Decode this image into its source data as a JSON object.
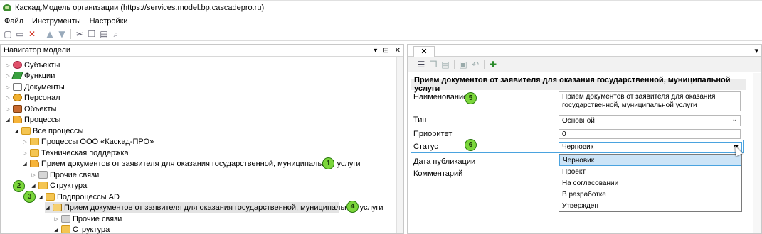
{
  "window": {
    "title": "Каскад.Модель организации (https://services.model.bp.cascadepro.ru)"
  },
  "menu": [
    "Файл",
    "Инструменты",
    "Настройки"
  ],
  "toolbar": {
    "icons": [
      "new-doc-icon",
      "open-icon",
      "delete-icon",
      "up-icon",
      "down-icon",
      "cut-icon",
      "copy-icon",
      "paste-icon",
      "preview-icon"
    ]
  },
  "navigator": {
    "title": "Навигатор модели",
    "header_buttons": [
      "▾",
      "⊞",
      "✕"
    ],
    "tree": [
      {
        "label": "Субъекты",
        "icon": "subj",
        "expander": "▷"
      },
      {
        "label": "Функции",
        "icon": "func",
        "expander": "▷"
      },
      {
        "label": "Документы",
        "icon": "doc",
        "expander": "▷"
      },
      {
        "label": "Персонал",
        "icon": "pers",
        "expander": "▷"
      },
      {
        "label": "Объекты",
        "icon": "obj",
        "expander": "▷"
      },
      {
        "label": "Процессы",
        "icon": "proc",
        "expander": "◢"
      },
      {
        "label": "Все процессы",
        "icon": "folder",
        "expander": "◢"
      },
      {
        "label": "Процессы ООО «Каскад-ПРО»",
        "icon": "folder",
        "expander": "▷"
      },
      {
        "label": "Техническая поддержка",
        "icon": "folder",
        "expander": "▷"
      },
      {
        "label": "Прием документов от заявителя для оказания государственной, муниципальной услуги",
        "icon": "proc",
        "expander": "◢"
      },
      {
        "label": "Прочие связи",
        "icon": "folder",
        "expander": "▷"
      },
      {
        "label": "Структура",
        "icon": "folder",
        "expander": "◢"
      },
      {
        "label": "Подпроцессы AD",
        "icon": "folder",
        "expander": "◢"
      },
      {
        "label": "Прием документов от заявителя для оказания государственной, муниципальной услуги",
        "icon": "proc-sel",
        "expander": "◢"
      },
      {
        "label": "Прочие связи",
        "icon": "folder",
        "expander": "▷"
      },
      {
        "label": "Структура",
        "icon": "folder",
        "expander": "◢"
      }
    ],
    "badges": [
      "1",
      "2",
      "3",
      "4"
    ]
  },
  "properties": {
    "tab_close": "✕",
    "menu_glyph": "▾",
    "title": "Прием документов от заявителя для оказания государственной, муниципальной услуги",
    "fields": {
      "name_label": "Наименование",
      "name_value": "Прием документов от заявителя для оказания государственной, муниципальной услуги",
      "type_label": "Тип",
      "type_value": "Основной",
      "priority_label": "Приоритет",
      "priority_value": "0",
      "status_label": "Статус",
      "status_value": "Черновик",
      "pubdate_label": "Дата публикации",
      "comment_label": "Комментарий"
    },
    "status_options": [
      "Черновик",
      "Проект",
      "На согласовании",
      "В разработке",
      "Утвержден"
    ],
    "badges": [
      "5",
      "6"
    ]
  },
  "colors": {
    "badge": "#7bd63b",
    "focus": "#4aa3df",
    "selection": "#cce4f7"
  }
}
